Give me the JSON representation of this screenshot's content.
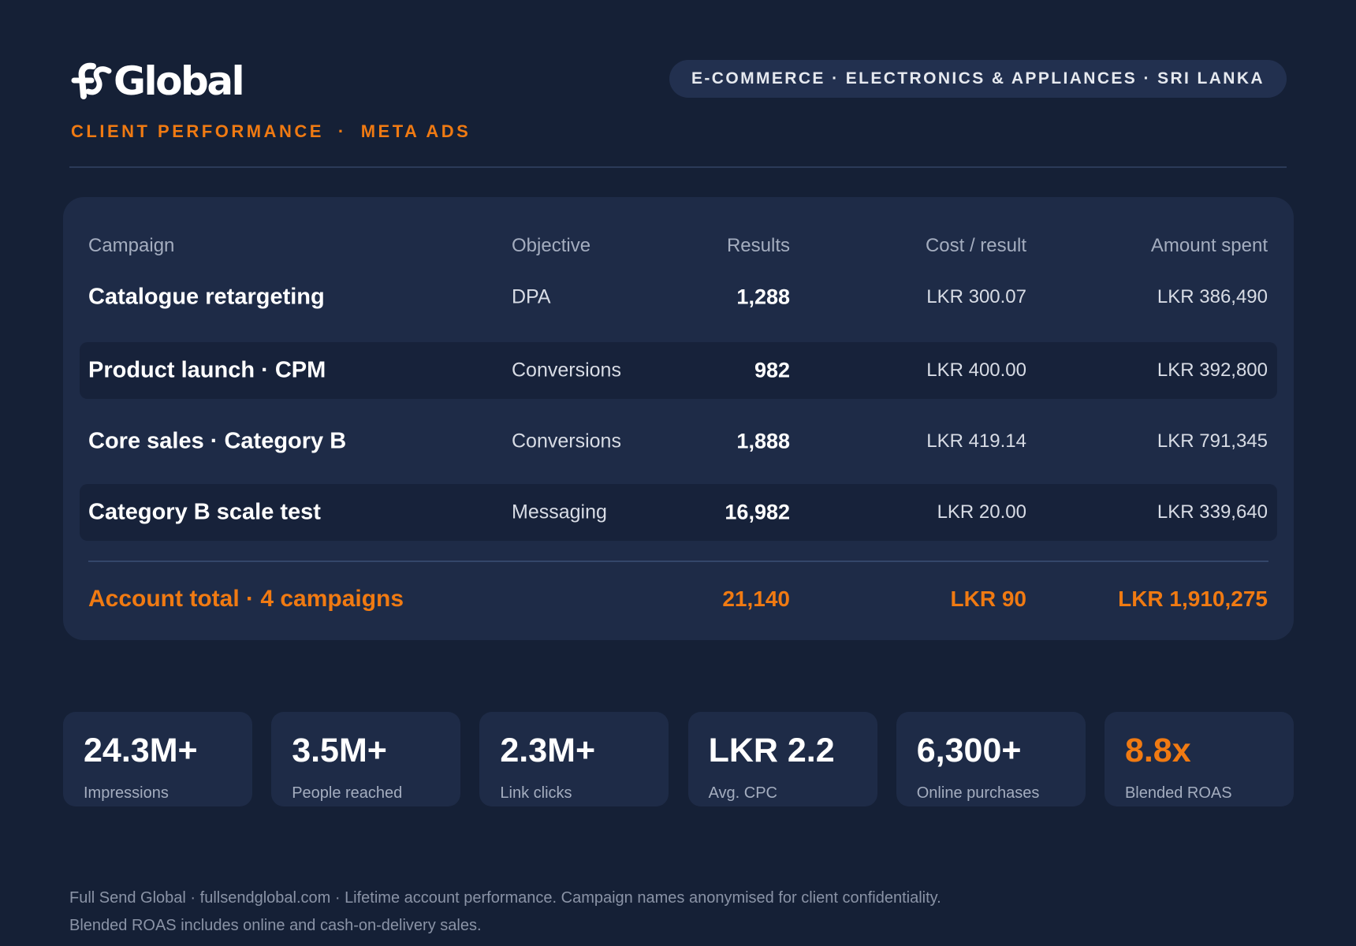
{
  "brand": {
    "logo_text": "Global",
    "subtitle_left": "CLIENT PERFORMANCE",
    "subtitle_sep": "·",
    "subtitle_right": "META ADS",
    "industry": "E-COMMERCE · ELECTRONICS & APPLIANCES · SRI LANKA"
  },
  "colors": {
    "background": "#152036",
    "card": "#1e2b47",
    "accent": "#f07a12"
  },
  "table": {
    "headers": {
      "campaign": "Campaign",
      "objective": "Objective",
      "results": "Results",
      "cost": "Cost / result",
      "spent": "Amount spent"
    },
    "rows": [
      {
        "campaign": "Catalogue retargeting",
        "objective": "DPA",
        "results": "1,288",
        "cost": "LKR 300.07",
        "spent": "LKR 386,490"
      },
      {
        "campaign": "Product launch · CPM",
        "objective": "Conversions",
        "results": "982",
        "cost": "LKR 400.00",
        "spent": "LKR 392,800"
      },
      {
        "campaign": "Core sales · Category B",
        "objective": "Conversions",
        "results": "1,888",
        "cost": "LKR 419.14",
        "spent": "LKR 791,345"
      },
      {
        "campaign": "Category B scale test",
        "objective": "Messaging",
        "results": "16,982",
        "cost": "LKR 20.00",
        "spent": "LKR 339,640"
      }
    ],
    "total": {
      "label": "Account total · 4 campaigns",
      "results": "21,140",
      "cost": "LKR 90",
      "spent": "LKR 1,910,275"
    }
  },
  "stats": [
    {
      "value": "24.3M+",
      "label": "Impressions"
    },
    {
      "value": "3.5M+",
      "label": "People reached"
    },
    {
      "value": "2.3M+",
      "label": "Link clicks"
    },
    {
      "value": "LKR 2.2",
      "label": "Avg. CPC"
    },
    {
      "value": "6,300+",
      "label": "Online purchases"
    },
    {
      "value": "8.8x",
      "label": "Blended ROAS"
    }
  ],
  "footer": {
    "line1": "Full Send Global · fullsendglobal.com · Lifetime account performance. Campaign names anonymised for client confidentiality.",
    "line2": "Blended ROAS includes online and cash-on-delivery sales."
  }
}
